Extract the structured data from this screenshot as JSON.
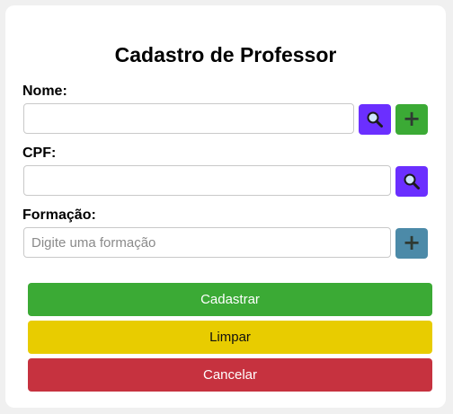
{
  "form": {
    "title": "Cadastro de Professor",
    "fields": {
      "nome": {
        "label": "Nome:",
        "value": "",
        "placeholder": ""
      },
      "cpf": {
        "label": "CPF:",
        "value": "",
        "placeholder": ""
      },
      "formacao": {
        "label": "Formação:",
        "value": "",
        "placeholder": "Digite uma formação"
      }
    },
    "icons": {
      "search": "magnifier-icon",
      "add": "plus-icon",
      "plus_glyph": "+"
    },
    "actions": {
      "cadastrar": "Cadastrar",
      "limpar": "Limpar",
      "cancelar": "Cancelar"
    }
  },
  "colors": {
    "page_background": "#f0f0f0",
    "search_button": "#6b2fff",
    "add_button_green": "#3baa35",
    "add_button_teal": "#4c8aa8",
    "cadastrar": "#3baa35",
    "limpar": "#e8cc00",
    "cancelar": "#c6323f"
  }
}
